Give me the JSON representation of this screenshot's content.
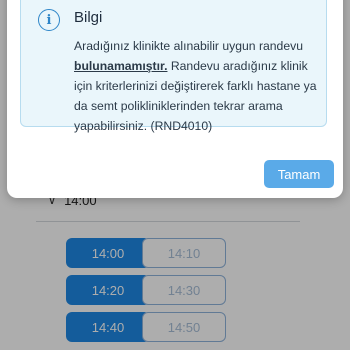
{
  "time_group": {
    "chevron": "∨",
    "label": "14:00"
  },
  "slots": [
    {
      "time": "14:00",
      "state": "available"
    },
    {
      "time": "14:10",
      "state": "disabled"
    },
    {
      "time": "14:20",
      "state": "available"
    },
    {
      "time": "14:30",
      "state": "disabled"
    },
    {
      "time": "14:40",
      "state": "available"
    },
    {
      "time": "14:50",
      "state": "disabled"
    }
  ],
  "dialog": {
    "icon": "i",
    "title": "Bilgi",
    "message_pre": "Aradığınız klinikte alınabilir uygun randevu ",
    "message_bold": "bulunamamıştır.",
    "message_post": " Randevu aradığınız klinik için kriterlerinizi değiştirerek farklı hastane ya da semt polikliniklerinden tekrar arama yapabilirsiniz. (RND4010)",
    "ok_label": "Tamam"
  },
  "colors": {
    "primary": "#1e88e5",
    "dialog_button": "#5aaae8",
    "info_background": "#eaf6fb",
    "info_border": "#b7dcef"
  }
}
